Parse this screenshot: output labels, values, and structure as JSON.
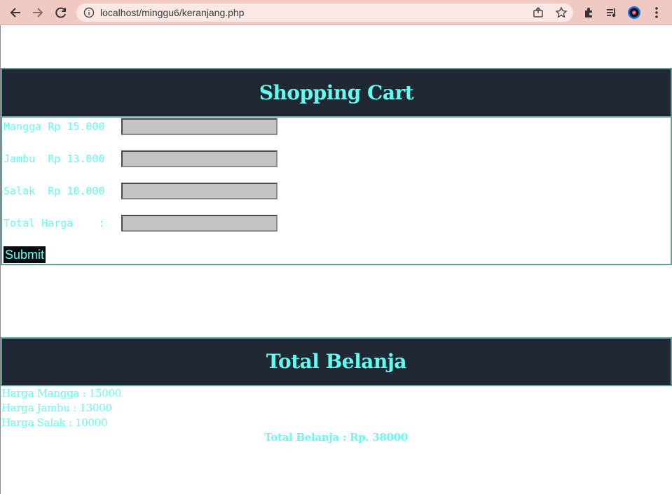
{
  "browser": {
    "url": "localhost/minggu6/keranjang.php",
    "icons": [
      "back-icon",
      "forward-icon",
      "reload-icon",
      "info-icon",
      "share-icon",
      "star-icon",
      "puzzle-icon",
      "media-icon",
      "profile-icon",
      "menu-icon"
    ]
  },
  "cart": {
    "title": "Shopping Cart",
    "rows": [
      {
        "label": "Mangga Rp 15.000",
        "value": ""
      },
      {
        "label": "Jambu  Rp 13.000",
        "value": ""
      },
      {
        "label": "Salak  Rp 10.000",
        "value": ""
      },
      {
        "label": "Total Harga    :",
        "value": ""
      }
    ],
    "submit_label": "Submit"
  },
  "summary": {
    "title": "Total Belanja",
    "lines": [
      "Harga Mangga : 15000",
      "Harga Jambu : 13000",
      "Harga Salak : 10000"
    ],
    "total": "Total Belanja : Rp. 38000"
  },
  "colors": {
    "accent": "#66fcf1",
    "header_bg": "#1f2833",
    "border": "#5aa39e",
    "chrome_bg": "#f1c9c3"
  }
}
